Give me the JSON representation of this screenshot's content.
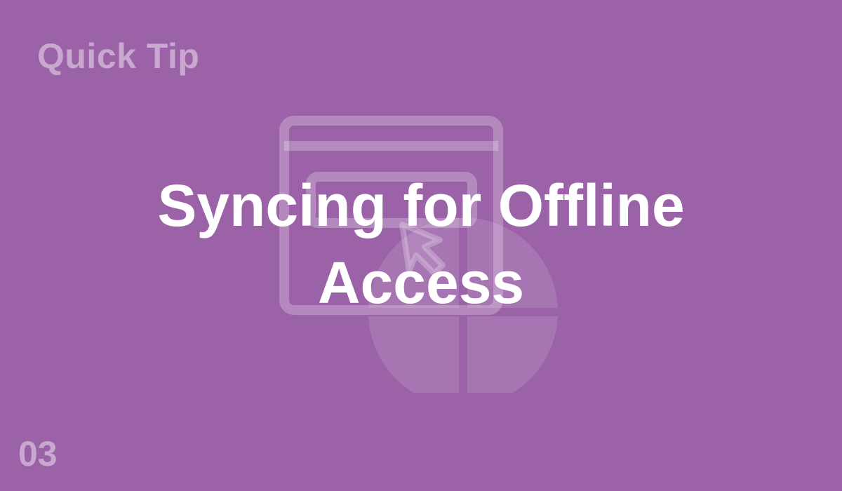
{
  "card": {
    "eyebrow": "Quick Tip",
    "title_line1": "Syncing for Offline",
    "title_line2": "Access",
    "number": "03"
  },
  "illustration": {
    "icon": "browser-window-cursor-globe-icon"
  },
  "colors": {
    "background": "#9b62a8",
    "title": "#ffffff",
    "muted_text": "rgba(255,255,255,0.45)"
  }
}
